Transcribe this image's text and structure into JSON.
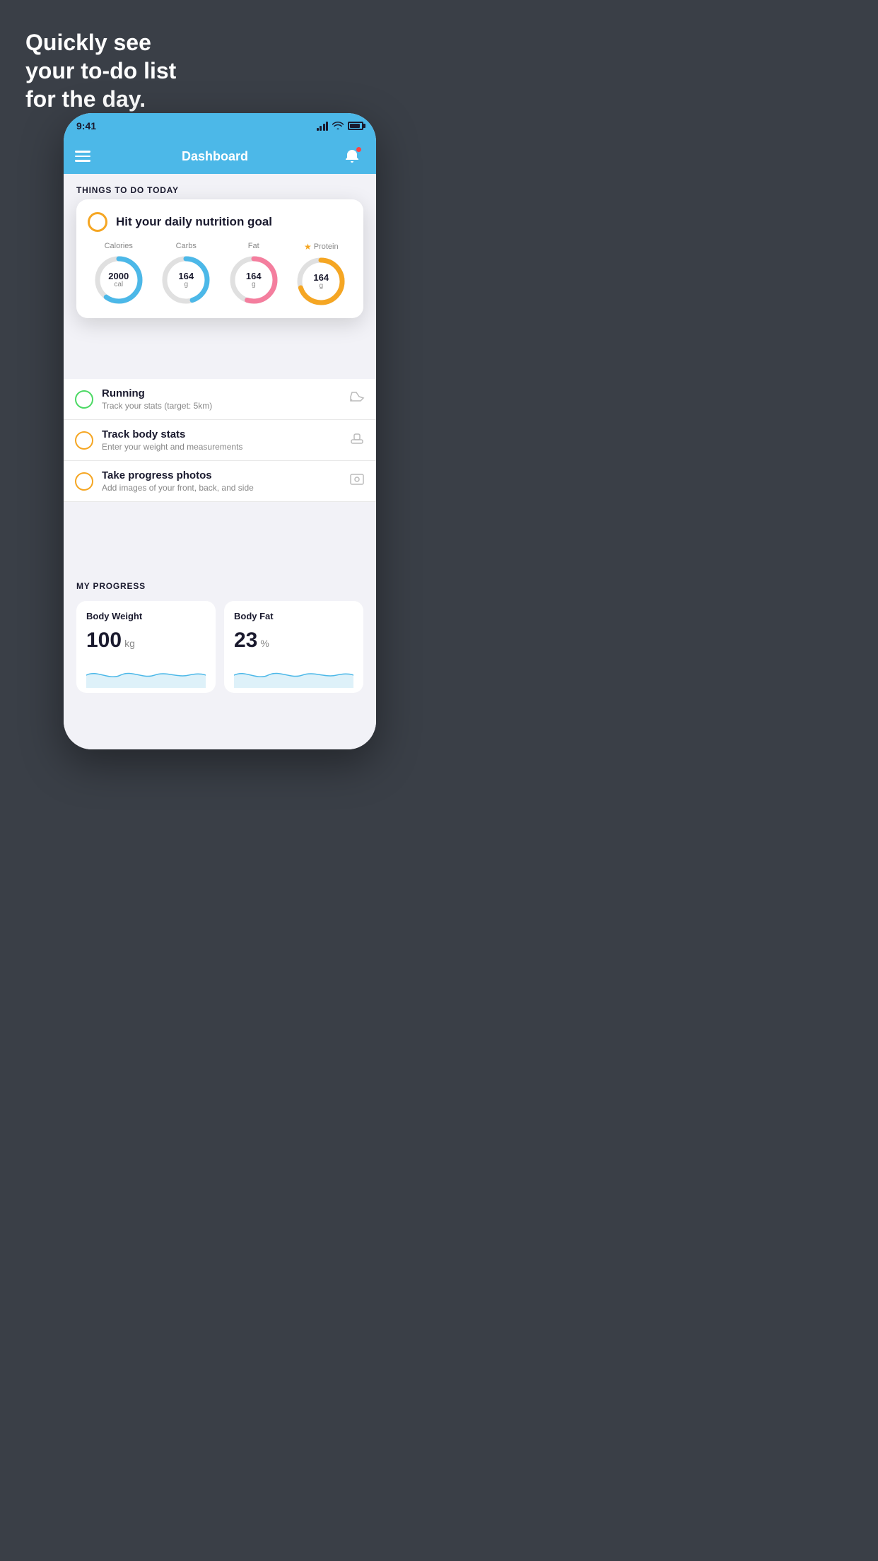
{
  "background": {
    "color": "#3a3f47"
  },
  "headline": {
    "line1": "Quickly see",
    "line2": "your to-do list",
    "line3": "for the day."
  },
  "phone": {
    "status_bar": {
      "time": "9:41"
    },
    "nav": {
      "title": "Dashboard"
    },
    "sections": {
      "things_today": {
        "label": "THINGS TO DO TODAY"
      },
      "my_progress": {
        "label": "MY PROGRESS"
      }
    },
    "floating_card": {
      "title": "Hit your daily nutrition goal",
      "nutrition": [
        {
          "label": "Calories",
          "value": "2000",
          "unit": "cal",
          "color": "#4cb8e8",
          "track_color": "#e0e0e0",
          "percent": 60,
          "starred": false
        },
        {
          "label": "Carbs",
          "value": "164",
          "unit": "g",
          "color": "#4cb8e8",
          "track_color": "#e0e0e0",
          "percent": 45,
          "starred": false
        },
        {
          "label": "Fat",
          "value": "164",
          "unit": "g",
          "color": "#f47e9e",
          "track_color": "#e0e0e0",
          "percent": 55,
          "starred": false
        },
        {
          "label": "Protein",
          "value": "164",
          "unit": "g",
          "color": "#f5a623",
          "track_color": "#e0e0e0",
          "percent": 70,
          "starred": true
        }
      ]
    },
    "todo_items": [
      {
        "name": "Running",
        "sub": "Track your stats (target: 5km)",
        "circle_color": "green",
        "icon": "👟"
      },
      {
        "name": "Track body stats",
        "sub": "Enter your weight and measurements",
        "circle_color": "yellow",
        "icon": "⚖️"
      },
      {
        "name": "Take progress photos",
        "sub": "Add images of your front, back, and side",
        "circle_color": "yellow",
        "icon": "🖼️"
      }
    ],
    "progress": [
      {
        "title": "Body Weight",
        "value": "100",
        "unit": "kg"
      },
      {
        "title": "Body Fat",
        "value": "23",
        "unit": "%"
      }
    ]
  }
}
